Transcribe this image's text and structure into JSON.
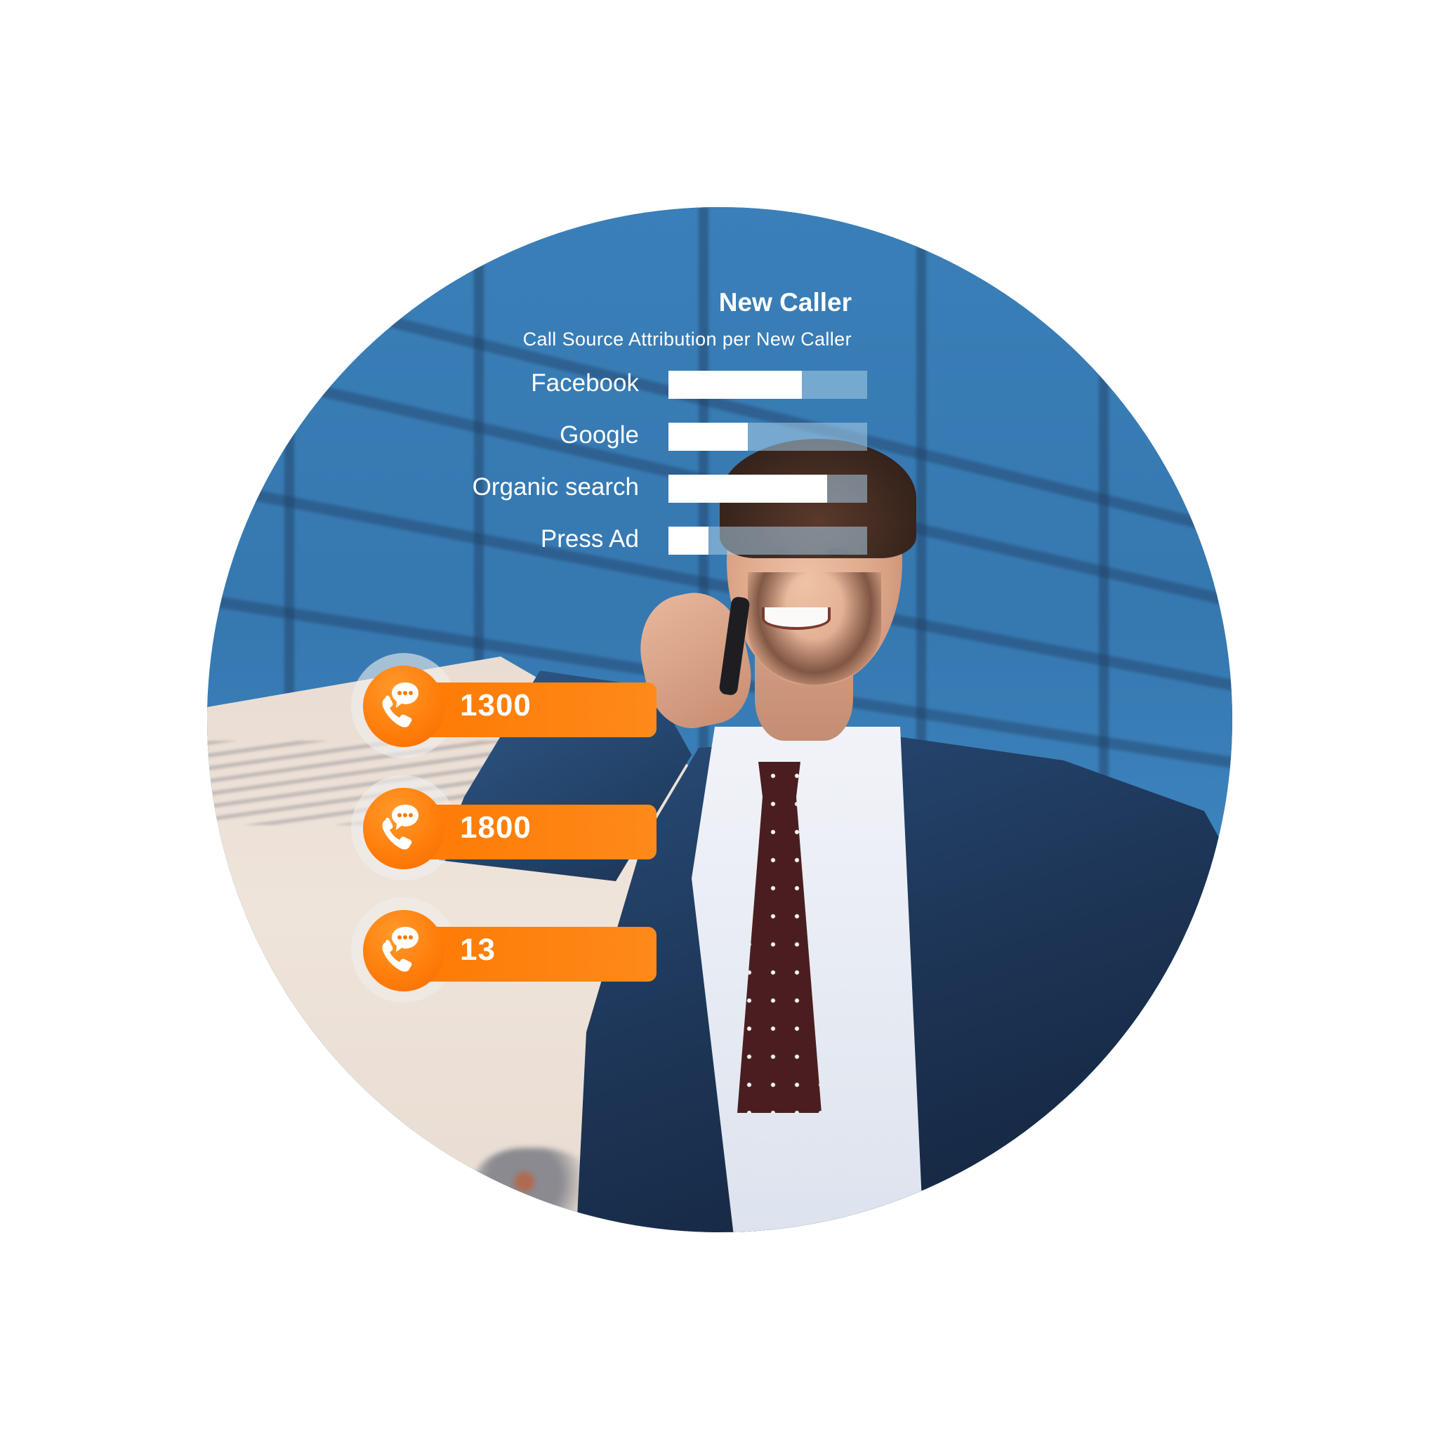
{
  "chart": {
    "title": "New Caller",
    "subtitle": "Call Source Attribution per New Caller"
  },
  "chart_data": {
    "type": "bar",
    "orientation": "horizontal",
    "title": "New Caller",
    "subtitle": "Call Source Attribution per New Caller",
    "categories": [
      "Facebook",
      "Google",
      "Organic search",
      "Press Ad"
    ],
    "values": [
      67,
      40,
      80,
      20
    ],
    "unit": "percent of track",
    "xlim": [
      0,
      100
    ],
    "grid": false,
    "legend": "none",
    "colors": {
      "fill": "#ffffff",
      "track": "#aacde8"
    }
  },
  "call_badges": [
    {
      "icon": "phone-chat-icon",
      "value": "1300"
    },
    {
      "icon": "phone-chat-icon",
      "value": "1800"
    },
    {
      "icon": "phone-chat-icon",
      "value": "13"
    }
  ],
  "colors": {
    "brand_orange": "#ff7a05",
    "sky_blue": "#3577ad",
    "text_light": "#ffffff"
  }
}
